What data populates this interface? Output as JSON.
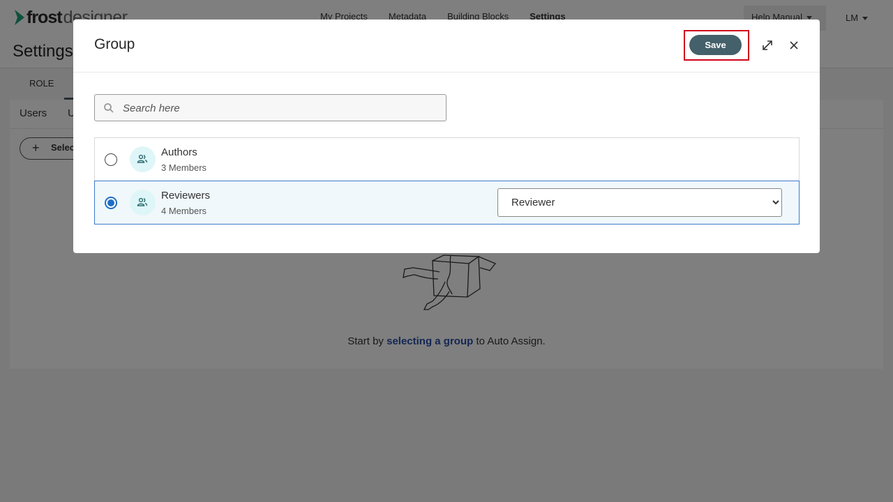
{
  "app": {
    "logo_part1": "frost",
    "logo_part2": "designer",
    "nav": [
      "My Projects",
      "Metadata",
      "Building Blocks",
      "Settings"
    ],
    "help_label": "Help Manual",
    "user_initials": "LM"
  },
  "page": {
    "title": "Settings",
    "tab_role": "ROLE",
    "panel_tab_users": "Users",
    "panel_tab_partial": "U",
    "select_button_label": "Selec",
    "empty_text_before": "Start by",
    "empty_link": "selecting a group",
    "empty_text_after": "to Auto Assign."
  },
  "modal": {
    "title": "Group",
    "save_label": "Save",
    "search_placeholder": "Search here",
    "groups": [
      {
        "name": "Authors",
        "members": "3 Members",
        "selected": false
      },
      {
        "name": "Reviewers",
        "members": "4 Members",
        "selected": true,
        "role": "Reviewer"
      }
    ],
    "role_options": [
      "Reviewer"
    ]
  },
  "colors": {
    "save_button": "#44606a",
    "highlight_border": "#d0021b",
    "selected_row_border": "#3f79c9",
    "selected_row_bg": "#f0f8fc",
    "radio_selected": "#1f6fc4",
    "link": "#2a4fa6",
    "avatar_bg": "#dff6f8",
    "logo_chevron": "#1aa37a"
  },
  "icons": {
    "logo": "chevron-right-icon",
    "search": "search-icon",
    "expand": "expand-icon",
    "close": "close-icon",
    "group": "group-people-icon",
    "add": "plus-icon"
  }
}
